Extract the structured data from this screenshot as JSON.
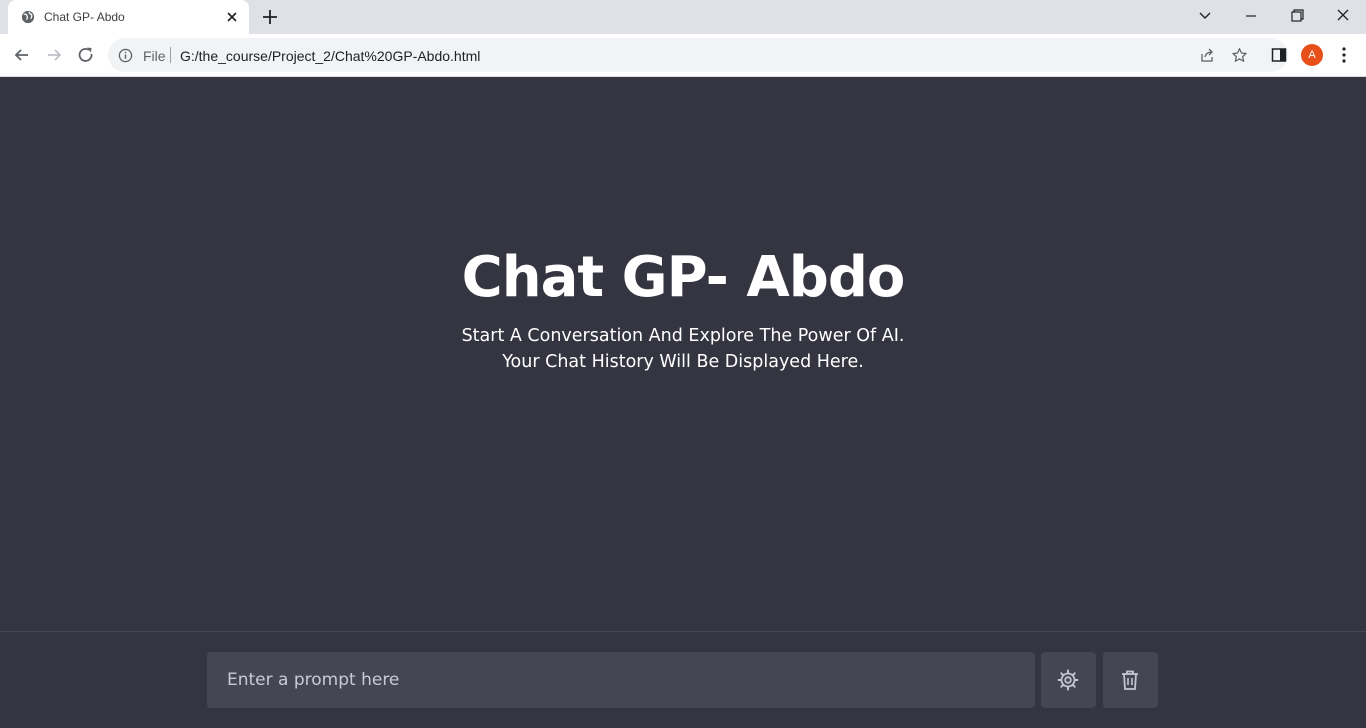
{
  "browser": {
    "tab_title": "Chat GP- Abdo",
    "url_scheme_label": "File",
    "url": "G:/the_course/Project_2/Chat%20GP-Abdo.html",
    "profile_initial": "A",
    "profile_color": "#e8501a"
  },
  "page": {
    "title": "Chat GP- Abdo",
    "subtitle_line1": "Start A Conversation And Explore The Power Of AI.",
    "subtitle_line2": "Your Chat History Will Be Displayed Here.",
    "background": "#343541"
  },
  "composer": {
    "placeholder": "Enter a prompt here",
    "value": "",
    "theme_button_icon": "settings-gear-icon",
    "delete_button_icon": "trash-icon"
  }
}
